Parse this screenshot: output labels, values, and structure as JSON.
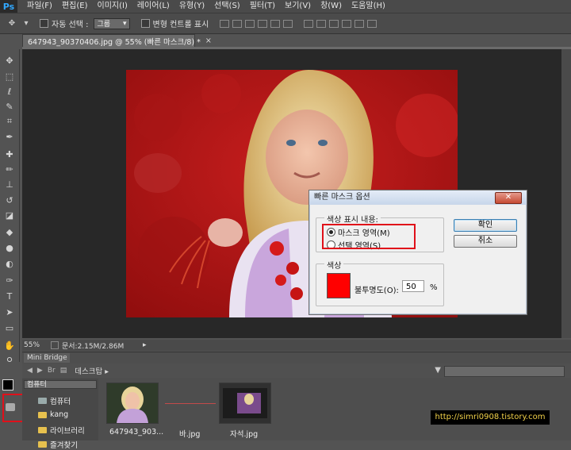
{
  "app": {
    "logo": "Ps"
  },
  "menu": [
    "파일(F)",
    "편집(E)",
    "이미지(I)",
    "레이어(L)",
    "유형(Y)",
    "선택(S)",
    "필터(T)",
    "보기(V)",
    "창(W)",
    "도움말(H)"
  ],
  "options": {
    "auto_select_label": "자동 선택 :",
    "auto_select_value": "그룹",
    "transform_label": "변형 컨트롤 표시"
  },
  "document": {
    "tab_title": "647943_90370406.jpg @ 55% (빠른 마스크/8) *",
    "close": "×",
    "zoom": "55%",
    "doc_size": "문서:2.15M/2.86M",
    "arrow": "▸"
  },
  "dialog": {
    "title": "빠른 마스크 옵션",
    "close": "✕",
    "color_indicates_label": "색상 표시 내용:",
    "option_masked": "마스크 영역(M)",
    "option_selected": "선택 영역(S)",
    "selected_option": "masked",
    "color_group_label": "색상",
    "swatch_color": "#ff0000",
    "opacity_label": "불투명도(O):",
    "opacity_value": "50",
    "opacity_unit": "%",
    "ok_label": "확인",
    "cancel_label": "취소"
  },
  "bridge": {
    "panel_title": "Mini Bridge",
    "path": "데스크탑 ▸",
    "location_select": "컴퓨터",
    "tree": [
      "컴퓨터",
      "kang",
      "라이브러리",
      "즐겨찾기"
    ],
    "thumbnails": [
      {
        "label": "647943_903..."
      },
      {
        "label": "바.jpg"
      },
      {
        "label": "자석.jpg"
      }
    ]
  },
  "watermark": "http://simri0908.tistory.com",
  "icons": [
    "move-icon",
    "marquee-icon",
    "lasso-icon",
    "quick-select-icon",
    "crop-icon",
    "eyedropper-icon",
    "healing-icon",
    "brush-icon",
    "stamp-icon",
    "history-brush-icon",
    "eraser-icon",
    "bucket-icon",
    "blur-icon",
    "dodge-icon",
    "pen-icon",
    "type-icon",
    "path-select-icon",
    "shape-icon",
    "hand-icon",
    "zoom-icon",
    "quick-mask-icon"
  ]
}
